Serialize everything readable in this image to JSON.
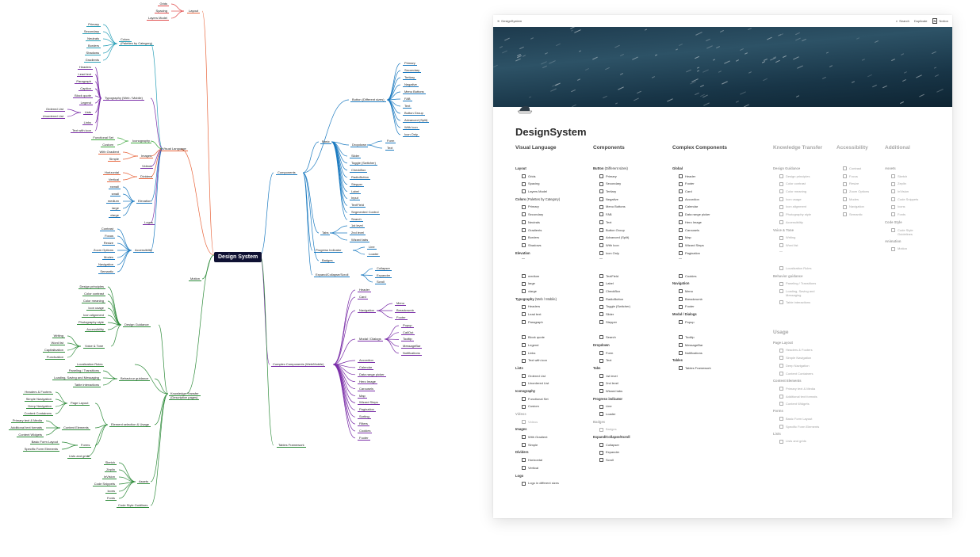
{
  "mindmap": {
    "root": "Design System",
    "visual_language": "Visual Language",
    "layout": "Layout",
    "layout_children": [
      "Grids",
      "Spacing",
      "Layers Model"
    ],
    "colors": "Colors\n(Palettes by Category)",
    "colors_children": [
      "Primary",
      "Secondary",
      "Neutrals",
      "Borders",
      "Shadows",
      "Gradients"
    ],
    "typography": "Typography (Web / Mobile)",
    "typo_children": [
      "Headers",
      "Lead text",
      "Paragraph",
      "Caption",
      "Block quote",
      "Legend"
    ],
    "lists": "Lists",
    "lists_children": [
      "Ordered List",
      "Unordered List"
    ],
    "links": "Links",
    "text_with_icon": "Text with icon",
    "iconography": "Iconography",
    "icon_children": [
      "Functional Set",
      "Custom"
    ],
    "images": "Images",
    "images_children": [
      "With Gradient",
      "Simple"
    ],
    "videos": "Videos",
    "dividers": "Dividers",
    "dividers_children": [
      "Horizontal",
      "Vertical"
    ],
    "elevation": "Elevation",
    "elevation_children": [
      "xsmall",
      "small",
      "medium",
      "large",
      "xlarge"
    ],
    "logos": "Logos",
    "accessibility": "Accessibility",
    "accessibility_children": [
      "Contrast",
      "Focus",
      "Resize",
      "Zoom Options",
      "Modes",
      "Navigation",
      "Semantic"
    ],
    "motion": "Motion",
    "knowledge": "Knowledge Transfer\n(Descriptive pages)",
    "design_guidance": "Design Guidance",
    "dg_children": [
      "Design principles",
      "Color contrast",
      "Color meaning",
      "Icon usage",
      "Icon alignment",
      "Photography style",
      "Accessibility"
    ],
    "voice": "Voice & Tone",
    "voice_children": [
      "Writing",
      "Word list",
      "Capitalisation",
      "Punctuation"
    ],
    "loc": "Localization Rules",
    "behaviour": "Behaviour guidance",
    "behaviour_children": [
      "Paneling / Transitions",
      "Loading, Saving and Messaging",
      "Table interactions"
    ],
    "element_sel": "Element selection & Usage",
    "page_layout": "Page Layout",
    "pl_children": [
      "Headers & Footers",
      "Simple Navigation",
      "Deep Navigation",
      "Content Containers"
    ],
    "content_elements": "Content Elements",
    "ce_children": [
      "Primary text & Media",
      "Additional text formats",
      "Content Widgets"
    ],
    "forms": "Forms",
    "forms_children": [
      "Basic Form Layout",
      "Specific Form Elements"
    ],
    "lists_grids": "Lists and grids",
    "assets": "Assets",
    "assets_children": [
      "Sketch",
      "Zeplin",
      "InVision",
      "Code Snippets",
      "Icons",
      "Fonts"
    ],
    "code_style": "Code Style Guidlines",
    "components": "Components",
    "button": "Button (Different sizes)",
    "button_children": [
      "Primary",
      "Secondary",
      "Tertiary",
      "Negative",
      "Menu Buttons",
      "FAB",
      "Text",
      "Button Group",
      "Advanced (Split)",
      "With Icon",
      "Icon Only"
    ],
    "basic": "Basic",
    "dropdown": "Dropdown",
    "dropdown_children": [
      "Form",
      "Text"
    ],
    "basic_children": [
      "Slider",
      "Toggle (Switcher)",
      "CheckBox",
      "RadioButton",
      "Stepper",
      "Label",
      "Input",
      "TextField",
      "Segmented Control",
      "Search"
    ],
    "tabs": "Tabs",
    "tabs_children": [
      "1st level",
      "2nd level",
      "Wizard tabs"
    ],
    "progress": "Progress Indicator",
    "progress_children": [
      "Line",
      "Loader"
    ],
    "badges": "Badges",
    "expand": "Expand/Collapse/Scroll",
    "expand_children": [
      "Collapser",
      "Expander",
      "Scroll"
    ],
    "complex": "Complex Components (Web/Mobile)",
    "complex_top": [
      "Header",
      "Card"
    ],
    "navigation": "Navigation",
    "nav_children": [
      "Menu",
      "Breadcrumb",
      "Footer"
    ],
    "modal": "Modal / Dialogs",
    "modal_children": [
      "Popup",
      "CallOut",
      "Tooltip",
      "MessageBar",
      "Notifications"
    ],
    "complex_rest": [
      "Accordion",
      "Calendar",
      "Data range picker",
      "Hero Image",
      "Carousels",
      "Map",
      "Wizard Steps",
      "Pagination",
      "Sorting",
      "Filters",
      "Cookies",
      "Footer"
    ],
    "tables": "Tables Framework"
  },
  "notion": {
    "crumb": "DesignSystem",
    "search": "Search",
    "duplicate": "Duplicate",
    "notion": "Notion",
    "title": "DesignSystem",
    "columns": [
      {
        "header": "Visual Language",
        "faded": false,
        "rows": [
          {
            "s": "Layout"
          },
          {
            "i": "Grids"
          },
          {
            "i": "Spacing"
          },
          {
            "i": "Layers Model"
          },
          {
            "s": "Colors",
            "suffix": " (Palettes by Category)"
          },
          {
            "i": "Primary"
          },
          {
            "i": "Secondary"
          },
          {
            "i": "Neutrals"
          },
          {
            "i": "Gradients"
          },
          {
            "i": "Borders"
          },
          {
            "i": "Shadows"
          },
          {
            "s": "Elevation"
          },
          {
            "h": 1
          },
          {
            "g": 1
          },
          {
            "i": "medium"
          },
          {
            "i": "large"
          },
          {
            "i": "xlarge"
          },
          {
            "s": "Typography",
            "suffix": " (Web / Mobile)"
          },
          {
            "i": "Headers"
          },
          {
            "i": "Lead text"
          },
          {
            "i": "Paragraph"
          },
          {
            "g": 1
          },
          {
            "i": "Block quote"
          },
          {
            "i": "Legend"
          },
          {
            "i": "Links"
          },
          {
            "i": "Text with icon"
          },
          {
            "s": "Lists"
          },
          {
            "i": "Ordered List"
          },
          {
            "i": "Unordered List"
          },
          {
            "s": "Iconography"
          },
          {
            "i": "Functional Set"
          },
          {
            "i": "Custom"
          },
          {
            "sf": "Videos"
          },
          {
            "if": "Videos"
          },
          {
            "s": "Images"
          },
          {
            "i": "With Gradient"
          },
          {
            "i": "Simple"
          },
          {
            "s": "Dividers"
          },
          {
            "i": "Horizontal"
          },
          {
            "i": "Vertical"
          },
          {
            "s": "Logo"
          },
          {
            "i": "Logo in different sizes"
          }
        ]
      },
      {
        "header": "Components",
        "faded": false,
        "rows": [
          {
            "s": "Button",
            "suffix": " (Different sizes)"
          },
          {
            "i": "Primary"
          },
          {
            "i": "Secondary"
          },
          {
            "i": "Tertiary"
          },
          {
            "i": "Negative"
          },
          {
            "i": "Menu Buttons"
          },
          {
            "i": "FAB"
          },
          {
            "i": "Text"
          },
          {
            "i": "Button Group"
          },
          {
            "i": "Advanced (Split)"
          },
          {
            "i": "With Icon"
          },
          {
            "i": "Icon Only"
          },
          {
            "h": 1
          },
          {
            "g": 1
          },
          {
            "i": "TextField"
          },
          {
            "i": "Label"
          },
          {
            "i": "CheckBox"
          },
          {
            "i": "RadioButton"
          },
          {
            "i": "Toggle (Switcher)"
          },
          {
            "i": "Slider"
          },
          {
            "i": "Stepper"
          },
          {
            "g": 1
          },
          {
            "i": "Search"
          },
          {
            "s": "Dropdown"
          },
          {
            "i": "Form"
          },
          {
            "i": "Text"
          },
          {
            "s": "Tabs"
          },
          {
            "i": "1st level"
          },
          {
            "i": "2nd level"
          },
          {
            "i": "Wizard tabs"
          },
          {
            "s": "Progress indicator"
          },
          {
            "i": "Line"
          },
          {
            "i": "Loader"
          },
          {
            "sf": "Badges"
          },
          {
            "if": "Badges"
          },
          {
            "s": "Expand/Collapse/Scroll"
          },
          {
            "i": "Collapser"
          },
          {
            "i": "Expander"
          },
          {
            "i": "Scroll"
          }
        ]
      },
      {
        "header": "Complex Components",
        "faded": false,
        "rows": [
          {
            "s": "Global"
          },
          {
            "i": "Header"
          },
          {
            "i": "Footer"
          },
          {
            "i": "Card"
          },
          {
            "i": "Accordion"
          },
          {
            "i": "Calendar"
          },
          {
            "i": "Data range picker"
          },
          {
            "i": "Hero Image"
          },
          {
            "i": "Carousels"
          },
          {
            "i": "Map"
          },
          {
            "i": "Wizard Steps"
          },
          {
            "i": "Pagination"
          },
          {
            "h": 1
          },
          {
            "g": 1
          },
          {
            "i": "Cookies"
          },
          {
            "s": "Navigation"
          },
          {
            "i": "Menu"
          },
          {
            "i": "Breadcrumb"
          },
          {
            "i": "Footer"
          },
          {
            "s": "Modal / Dialogs"
          },
          {
            "i": "Popup"
          },
          {
            "g": 1
          },
          {
            "i": "Tooltip"
          },
          {
            "i": "MessageBar"
          },
          {
            "i": "Notifications"
          },
          {
            "s": "Tables"
          },
          {
            "i": "Tables Framework"
          }
        ]
      },
      {
        "header": "Knowledge Transfer",
        "faded": true,
        "rows": [
          {
            "s": "Design Guidance"
          },
          {
            "i": "Design principles"
          },
          {
            "i": "Color contrast"
          },
          {
            "i": "Color meaning"
          },
          {
            "i": "Icon usage"
          },
          {
            "i": "Icon alignment"
          },
          {
            "i": "Photography style"
          },
          {
            "i": "Accessibility"
          },
          {
            "s": "Voice & Tone"
          },
          {
            "i": "Writing"
          },
          {
            "i": "Word list"
          },
          {
            "h": 1
          },
          {
            "g": 1
          },
          {
            "i": "Localization Rules"
          },
          {
            "s": "Behavior guidance"
          },
          {
            "i": "Paneling / Transitions"
          },
          {
            "i": "Loading, Saving and Messaging",
            "wrap": 1
          },
          {
            "i": "Table interactions"
          },
          {
            "g": 1
          },
          {
            "g": 1
          },
          {
            "g": 1
          },
          {
            "head2": "Usage"
          },
          {
            "s": "Page Layout"
          },
          {
            "i": "Headers & Footers"
          },
          {
            "i": "Simple Navigation"
          },
          {
            "i": "Deep Navigation"
          },
          {
            "i": "Content Containers"
          },
          {
            "s": "Content Elements"
          },
          {
            "i": "Primary text & Media"
          },
          {
            "i": "Additional text formats",
            "wrap": 1
          },
          {
            "i": "Content Widgets"
          },
          {
            "s": "Forms"
          },
          {
            "i": "Basic Form Layout"
          },
          {
            "i": "Specific Form Elements",
            "wrap": 1
          },
          {
            "s": "Lists"
          },
          {
            "i": "Lists and grids"
          }
        ]
      },
      {
        "header": "Accessibility",
        "faded": true,
        "rows": [
          {
            "i": "Contrast"
          },
          {
            "i": "Focus"
          },
          {
            "i": "Resize"
          },
          {
            "i": "Zoom Options"
          },
          {
            "i": "Modes"
          },
          {
            "i": "Navigation"
          },
          {
            "i": "Semantic"
          }
        ]
      },
      {
        "header": "Additional",
        "faded": true,
        "rows": [
          {
            "s": "Assets"
          },
          {
            "i": "Sketch"
          },
          {
            "i": "Zeplin"
          },
          {
            "i": "InVision"
          },
          {
            "i": "Code Snippets"
          },
          {
            "i": "Icons"
          },
          {
            "i": "Fonts"
          },
          {
            "s": "Code Style"
          },
          {
            "i": "Code Style Guidelines",
            "wrap": 1
          },
          {
            "s": "Animation"
          },
          {
            "i": "Motion"
          }
        ]
      }
    ]
  }
}
